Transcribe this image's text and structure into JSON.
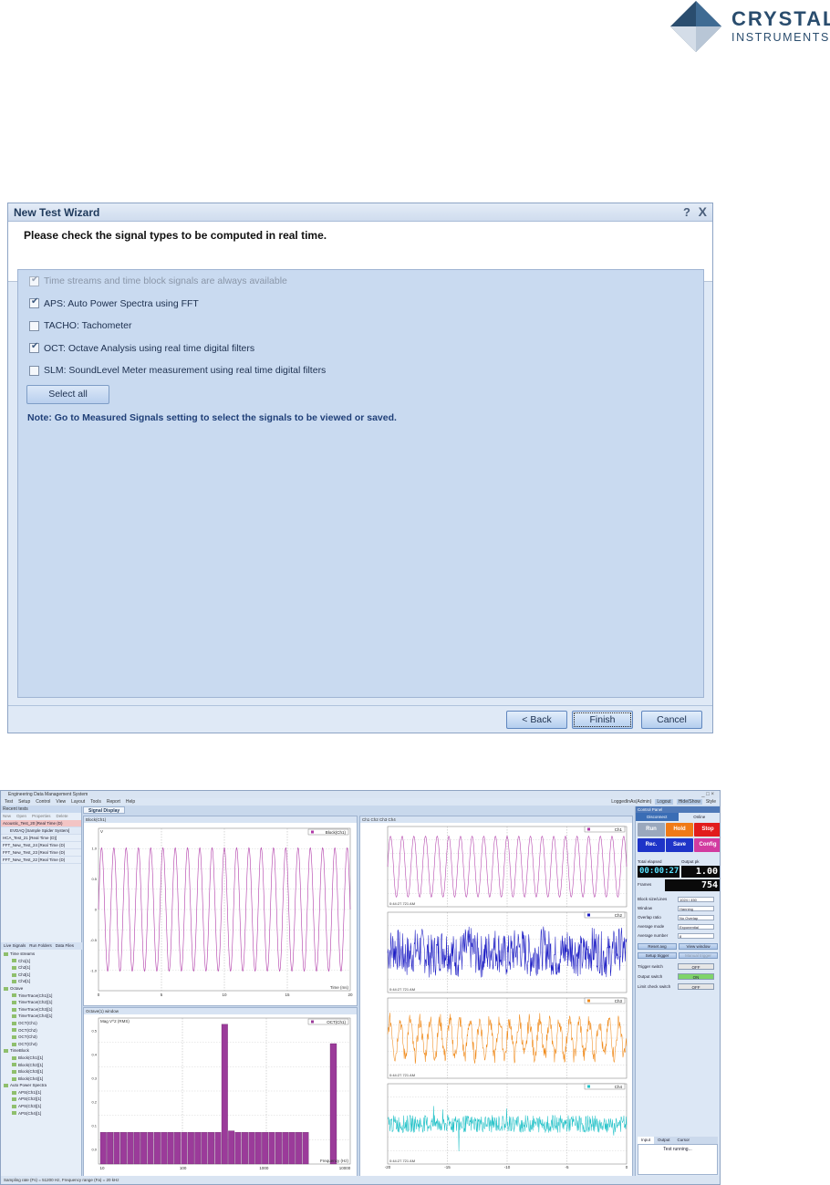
{
  "logo": {
    "line1": "CRYSTAL",
    "line2": "INSTRUMENTS",
    "colors": {
      "dark": "#2a4d6e",
      "light": "#b8c6d6"
    }
  },
  "wizard": {
    "title": "New Test Wizard",
    "help_icon": "?",
    "close_icon": "X",
    "prompt": "Please check the signal types to be computed in real time.",
    "options": [
      {
        "label": "Time streams and time block signals are always available",
        "checked": true,
        "disabled": true
      },
      {
        "label": "APS: Auto Power Spectra using FFT",
        "checked": true,
        "disabled": false
      },
      {
        "label": "TACHO: Tachometer",
        "checked": false,
        "disabled": false
      },
      {
        "label": "OCT: Octave Analysis using real time digital filters",
        "checked": true,
        "disabled": false
      },
      {
        "label": "SLM: SoundLevel Meter measurement using real time digital filters",
        "checked": false,
        "disabled": false
      }
    ],
    "select_all_label": "Select all",
    "note": "Note: Go to Measured Signals setting to select the signals to be viewed or saved.",
    "buttons": {
      "back": "< Back",
      "finish": "Finish",
      "cancel": "Cancel"
    }
  },
  "app": {
    "title": "Engineering Data Management System",
    "menu": [
      "Test",
      "Setup",
      "Control",
      "View",
      "Layout",
      "Tools",
      "Report",
      "Help"
    ],
    "right_tools": [
      "LoggedInAs(Admin)",
      "Logout",
      "Hide/Show",
      "Style"
    ],
    "recent_pane": {
      "title": "Recent tests",
      "tools": [
        "New",
        "Open",
        "Properties",
        "Delete"
      ],
      "items": [
        {
          "label": "Acoustic_Test_20  [Real Time (D)",
          "selected": true,
          "child": false
        },
        {
          "label": "EVDAQ [Sample Spider System]",
          "selected": false,
          "child": true
        },
        {
          "label": "HCA_Test_21  [Real Time (D)]",
          "selected": false,
          "child": false
        },
        {
          "label": "FFT_New_Test_24  [Real Time (D)",
          "selected": false,
          "child": false
        },
        {
          "label": "FFT_New_Test_23  [Real Time (D)",
          "selected": false,
          "child": false
        },
        {
          "label": "FFT_New_Test_22  [Real Time (D)",
          "selected": false,
          "child": false
        }
      ]
    },
    "left_tabs": [
      "Live Signals",
      "Run Folders",
      "Data Files"
    ],
    "tree": [
      {
        "group": "Time streams",
        "leaves": [
          "Ch1[1]",
          "Ch2[1]",
          "Ch3[1]",
          "Ch4[1]"
        ]
      },
      {
        "group": "Octave",
        "leaves": [
          "TimeTrace(Ch1)[1]",
          "TimeTrace(Ch2)[1]",
          "TimeTrace(Ch3)[1]",
          "TimeTrace(Ch4)[1]",
          "OCT(Ch1)",
          "OCT(Ch2)",
          "OCT(Ch3)",
          "OCT(Ch4)"
        ]
      },
      {
        "group": "TimeBlock",
        "leaves": [
          "Block(Ch1)[1]",
          "Block(Ch2)[1]",
          "Block(Ch3)[1]",
          "Block(Ch4)[1]"
        ]
      },
      {
        "group": "Auto Power Spectra",
        "leaves": [
          "APS(Ch1)[1]",
          "APS(Ch2)[1]",
          "APS(Ch3)[1]",
          "APS(Ch4)[1]"
        ]
      }
    ],
    "doc_tab": "Signal Display",
    "plots": {
      "block": {
        "header": "Block(Ch1)",
        "legend": "Block(Ch1)",
        "xlabel": "Time (ms)",
        "ylabel": "V",
        "xticks": [
          "0",
          "5",
          "10",
          "15",
          "20"
        ],
        "yticks": [
          "1.0",
          "0.5",
          "0",
          "-0.5",
          "-1.0"
        ],
        "color": "#b03aa8"
      },
      "oct": {
        "header": "Octave(1) window",
        "legend": "OCT(Ch1)",
        "xlabel": "Frequency (Hz)",
        "ylabel": "Mag V^2 (RMS)",
        "xticks": [
          "10",
          "100",
          "1000",
          "10000"
        ],
        "yticks": [
          "0.5",
          "0.4",
          "0.3",
          "0.2",
          "0.1",
          "0.0"
        ],
        "color": "#9b3b9a"
      },
      "stack": {
        "header": "Ch1 Ch2 Ch3 Ch4",
        "xlabel": "Time (ms)",
        "xticks": [
          "-20",
          "-15",
          "-10",
          "-5",
          "0"
        ],
        "timestamp": "0:44:27.721 AM",
        "channels": [
          {
            "name": "Ch1",
            "color": "#b03aa8"
          },
          {
            "name": "Ch2",
            "color": "#1c1cc4"
          },
          {
            "name": "Ch3",
            "color": "#f08a1a"
          },
          {
            "name": "Ch4",
            "color": "#22c2c8"
          }
        ]
      }
    },
    "control_panel": {
      "title": "Control Panel",
      "tabs": [
        "Disconnect",
        "Online"
      ],
      "buttons": [
        {
          "label": "Run",
          "color": "#9aa8bd"
        },
        {
          "label": "Hold",
          "color": "#f07a17"
        },
        {
          "label": "Stop",
          "color": "#e21c1c"
        },
        {
          "label": "Rec.",
          "color": "#1e34c8"
        },
        {
          "label": "Save",
          "color": "#1e34c8"
        },
        {
          "label": "Config",
          "color": "#d23ba0"
        }
      ],
      "total_elapsed_label": "Total elapsed",
      "total_elapsed": "00:00:27",
      "output_pk_label": "Output pk",
      "output_pk": "1.00",
      "frames_label": "Frames",
      "frames": "754",
      "settings": [
        {
          "label": "Block size/Lines",
          "value": "1024 / 450"
        },
        {
          "label": "Window",
          "value": "Hanning"
        },
        {
          "label": "Overlap ratio",
          "value": "No Overlap"
        },
        {
          "label": "Average mode",
          "value": "Exponential"
        },
        {
          "label": "Average number",
          "value": "8"
        }
      ],
      "reset_avg": "Reset avg",
      "view_window": "View window",
      "setup_trigger": "Setup trigger",
      "manual_trigger": "Manual trigger",
      "switches": [
        {
          "label": "Trigger switch",
          "value": "OFF",
          "color": "#e6e6e6"
        },
        {
          "label": "Output switch",
          "value": "ON",
          "color": "#7fd46a"
        },
        {
          "label": "Limit check switch",
          "value": "OFF",
          "color": "#e6e6e6"
        }
      ],
      "bottom_tabs": [
        "Input",
        "Output",
        "Cursor"
      ],
      "message": "Test running..."
    },
    "status": "Sampling rate (Fs) = 51200 Hz, Frequency range (Fa) = 20 kHz"
  }
}
